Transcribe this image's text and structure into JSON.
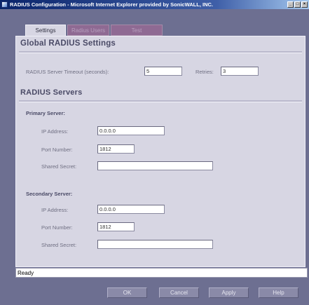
{
  "window": {
    "title": "RADIUS Configuration - Microsoft Internet Explorer provided by SonicWALL, INC.",
    "controls": [
      "minimize-icon",
      "maximize-icon",
      "close-icon"
    ]
  },
  "tabs": [
    {
      "label": "Settings",
      "active": true
    },
    {
      "label": "Radius Users",
      "active": false
    },
    {
      "label": "Test",
      "active": false
    }
  ],
  "global": {
    "heading": "Global RADIUS Settings",
    "timeout_label": "RADIUS Server Timeout (seconds):",
    "timeout_value": "5",
    "retries_label": "Retries:",
    "retries_value": "3"
  },
  "servers": {
    "heading": "RADIUS Servers",
    "primary": {
      "title": "Primary Server:",
      "ip_label": "IP Address:",
      "ip_value": "0.0.0.0",
      "port_label": "Port Number:",
      "port_value": "1812",
      "secret_label": "Shared Secret:",
      "secret_value": ""
    },
    "secondary": {
      "title": "Secondary Server:",
      "ip_label": "IP Address:",
      "ip_value": "0.0.0.0",
      "port_label": "Port Number:",
      "port_value": "1812",
      "secret_label": "Shared Secret:",
      "secret_value": ""
    }
  },
  "status": "Ready",
  "buttons": {
    "ok": "OK",
    "cancel": "Cancel",
    "apply": "Apply",
    "help": "Help"
  }
}
